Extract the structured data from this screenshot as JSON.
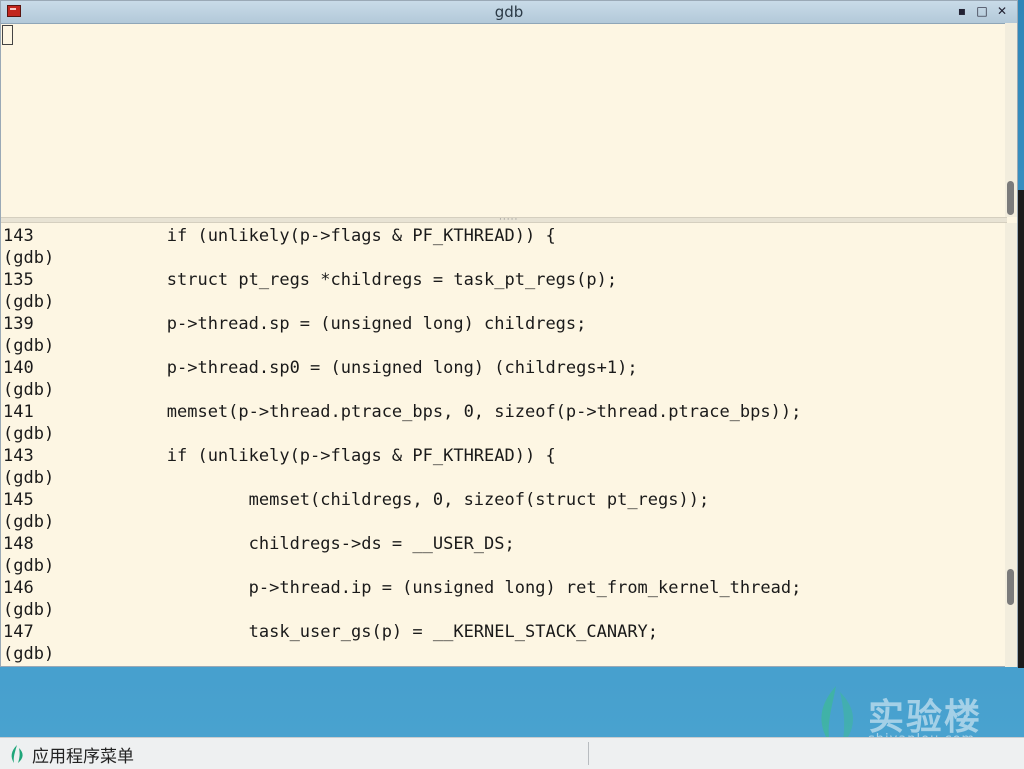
{
  "window": {
    "title": "gdb"
  },
  "colors": {
    "terminal_bg": "#fdf6e3",
    "desktop": "#3c95c6",
    "app_icon": "#c2261d"
  },
  "icons": {
    "app": "terminal-icon",
    "minimize": "minimize-icon",
    "maximize": "maximize-icon",
    "close": "close-icon",
    "menu": "leaf-icon"
  },
  "terminal": {
    "lines": [
      "143             if (unlikely(p->flags & PF_KTHREAD)) {",
      "(gdb)",
      "135             struct pt_regs *childregs = task_pt_regs(p);",
      "(gdb)",
      "139             p->thread.sp = (unsigned long) childregs;",
      "(gdb)",
      "140             p->thread.sp0 = (unsigned long) (childregs+1);",
      "(gdb)",
      "141             memset(p->thread.ptrace_bps, 0, sizeof(p->thread.ptrace_bps));",
      "(gdb)",
      "143             if (unlikely(p->flags & PF_KTHREAD)) {",
      "(gdb)",
      "145                     memset(childregs, 0, sizeof(struct pt_regs));",
      "(gdb)",
      "148                     childregs->ds = __USER_DS;",
      "(gdb)",
      "146                     p->thread.ip = (unsigned long) ret_from_kernel_thread;",
      "(gdb)",
      "147                     task_user_gs(p) = __KERNEL_STACK_CANARY;",
      "(gdb)"
    ]
  },
  "taskbar": {
    "menu_label": "应用程序菜单"
  },
  "watermark": {
    "name": "实验楼",
    "url": "shiyanlou.com"
  }
}
